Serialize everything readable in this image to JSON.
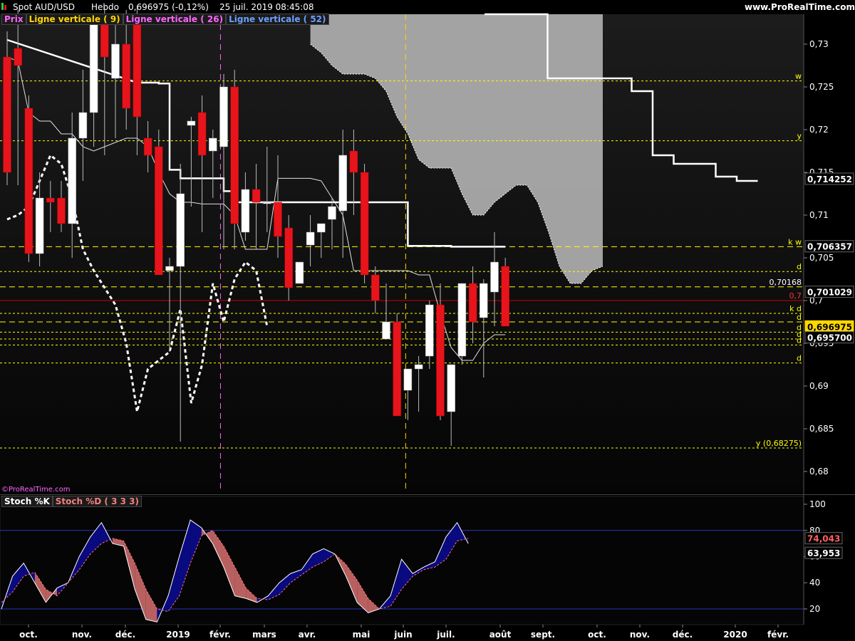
{
  "header": {
    "instrument": "Spot AUD/USD",
    "period": "Hebdo",
    "quote": "0,696975 (-0,12%)",
    "datetime": "25 juil. 2019 08:45:08",
    "site": "www.ProRealTime.com"
  },
  "legend": {
    "prix": "Prix",
    "lv9": "Ligne verticale ( 9)",
    "lv26": "Ligne verticale ( 26)",
    "lv52": "Ligne verticale ( 52)",
    "watermark": "©ProRealTime.com"
  },
  "stoch_legend": {
    "k": "Stoch %K",
    "d": "Stoch %D ( 3 3 3)"
  },
  "colors": {
    "bull": "#ffffff",
    "bear": "#e8141c",
    "level_line": "#ffff00",
    "cloud": "#b3b3b3",
    "k_fill_up": "#0a0a80",
    "k_fill_down": "#b86060",
    "lv9": "#ffd700",
    "lv26": "#ff66ff",
    "lv52": "#6f9fff"
  },
  "chart_data": {
    "type": "candlestick",
    "x_labels": [
      "oct.",
      "nov.",
      "déc.",
      "2019",
      "févr.",
      "mars",
      "avr.",
      "mai",
      "juin",
      "juil.",
      "août",
      "sept.",
      "oct.",
      "nov.",
      "déc.",
      "2020",
      "févr."
    ],
    "y_ticks": [
      "0,73",
      "0,725",
      "0,72",
      "0,715",
      "0,71",
      "0,705",
      "0,7",
      "0,695",
      "0,69",
      "0,685",
      "0,68"
    ],
    "ylim": [
      0.6775,
      0.7335
    ],
    "candles": [
      [
        0.7285,
        0.7315,
        0.7135,
        0.715
      ],
      [
        0.7295,
        0.734,
        0.7135,
        0.7275
      ],
      [
        0.7225,
        0.724,
        0.7045,
        0.7055
      ],
      [
        0.7055,
        0.715,
        0.704,
        0.712
      ],
      [
        0.712,
        0.714,
        0.708,
        0.7115
      ],
      [
        0.712,
        0.714,
        0.708,
        0.709
      ],
      [
        0.709,
        0.722,
        0.705,
        0.719
      ],
      [
        0.719,
        0.727,
        0.714,
        0.722
      ],
      [
        0.722,
        0.733,
        0.718,
        0.7335
      ],
      [
        0.7335,
        0.7345,
        0.717,
        0.7285
      ],
      [
        0.726,
        0.733,
        0.719,
        0.73
      ],
      [
        0.73,
        0.734,
        0.72,
        0.7225
      ],
      [
        0.7335,
        0.7345,
        0.717,
        0.7215
      ],
      [
        0.719,
        0.721,
        0.715,
        0.717
      ],
      [
        0.718,
        0.72,
        0.703,
        0.703
      ],
      [
        0.7035,
        0.705,
        0.694,
        0.704
      ],
      [
        0.704,
        0.716,
        0.6835,
        0.7125
      ],
      [
        0.7205,
        0.7215,
        0.711,
        0.721
      ],
      [
        0.722,
        0.724,
        0.708,
        0.717
      ],
      [
        0.7175,
        0.72,
        0.712,
        0.719
      ],
      [
        0.718,
        0.7265,
        0.706,
        0.725
      ],
      [
        0.725,
        0.727,
        0.706,
        0.709
      ],
      [
        0.708,
        0.715,
        0.707,
        0.713
      ],
      [
        0.713,
        0.716,
        0.706,
        0.7115
      ],
      [
        0.7115,
        0.718,
        0.708,
        0.7115
      ],
      [
        0.7115,
        0.717,
        0.705,
        0.7075
      ],
      [
        0.7085,
        0.71,
        0.7,
        0.7015
      ],
      [
        0.702,
        0.704,
        0.702,
        0.7045
      ],
      [
        0.7065,
        0.71,
        0.704,
        0.708
      ],
      [
        0.708,
        0.709,
        0.705,
        0.709
      ],
      [
        0.7095,
        0.712,
        0.706,
        0.711
      ],
      [
        0.7105,
        0.72,
        0.705,
        0.717
      ],
      [
        0.7175,
        0.72,
        0.71,
        0.715
      ],
      [
        0.715,
        0.716,
        0.702,
        0.703
      ],
      [
        0.703,
        0.704,
        0.6985,
        0.7
      ],
      [
        0.6955,
        0.702,
        0.6955,
        0.6975
      ],
      [
        0.6975,
        0.6985,
        0.6865,
        0.6865
      ],
      [
        0.6895,
        0.6905,
        0.686,
        0.692
      ],
      [
        0.692,
        0.6935,
        0.687,
        0.6925
      ],
      [
        0.6935,
        0.7,
        0.692,
        0.6995
      ],
      [
        0.6995,
        0.702,
        0.686,
        0.6865
      ],
      [
        0.687,
        0.6925,
        0.683,
        0.6925
      ],
      [
        0.6935,
        0.702,
        0.6925,
        0.702
      ],
      [
        0.702,
        0.704,
        0.695,
        0.6975
      ],
      [
        0.698,
        0.7025,
        0.691,
        0.702
      ],
      [
        0.701,
        0.708,
        0.697,
        0.7045
      ],
      [
        0.704,
        0.705,
        0.697,
        0.697
      ]
    ],
    "kijun": [
      0.7305,
      null,
      null,
      null,
      null,
      null,
      null,
      null,
      null,
      null,
      null,
      null,
      0.7255,
      0.7255,
      0.7254,
      0.7153,
      0.7143,
      0.7143,
      0.7143,
      0.7143,
      0.7128,
      0.7115,
      0.7115,
      0.7115,
      0.7115,
      0.7115,
      0.7115,
      0.7115,
      0.7115,
      0.7115,
      0.7115,
      0.7115,
      0.7115,
      0.7115,
      0.7115,
      0.7115,
      0.7115,
      0.7064,
      0.7064,
      0.7064,
      0.7064,
      0.7063,
      0.7063,
      0.7063,
      0.7063,
      0.7063,
      0.7063
    ],
    "tenkan": [
      0.7285,
      0.728,
      0.722,
      0.721,
      0.721,
      0.7195,
      0.7195,
      0.718,
      0.7175,
      0.718,
      0.7185,
      0.719,
      0.719,
      0.718,
      0.715,
      0.7125,
      0.7115,
      0.7115,
      0.7113,
      0.7113,
      0.7113,
      0.71,
      0.706,
      0.706,
      0.706,
      0.7143,
      0.7143,
      0.7143,
      0.7143,
      0.714,
      0.712,
      0.71,
      0.7035,
      0.7035,
      0.7035,
      0.7035,
      0.7035,
      0.7035,
      0.703,
      0.703,
      0.6985,
      0.6945,
      0.693,
      0.693,
      0.695,
      0.696,
      0.696
    ],
    "chikou": [
      0.7095,
      0.71,
      0.711,
      0.714,
      0.717,
      0.716,
      0.712,
      0.706,
      0.7035,
      0.7015,
      0.6995,
      0.695,
      0.687,
      0.692,
      0.693,
      0.694,
      0.699,
      0.688,
      0.6925,
      0.702,
      0.6975,
      0.7025,
      0.7045,
      0.7035,
      0.697
    ],
    "senkou_upper": [
      0.73,
      0.729,
      0.7275,
      0.7265,
      0.7265,
      0.7265,
      0.726,
      0.7245,
      0.7215,
      0.7195,
      0.7165,
      0.7155,
      0.7155,
      0.7155,
      0.7125,
      0.71,
      0.71,
      0.7115,
      0.7125,
      0.7135,
      0.7135,
      0.7115,
      0.708,
      0.704,
      0.702,
      0.702,
      0.7035,
      0.704
    ],
    "senkou_lower": [
      0.7335,
      0.7335,
      0.7335,
      0.7335,
      0.7335,
      0.7335,
      0.7335,
      0.7335,
      0.7335,
      0.7335,
      0.7335,
      0.7335,
      0.7335,
      0.7335,
      0.7335,
      0.7335,
      0.7335,
      0.7335,
      0.7335,
      0.7335,
      0.7335,
      0.7335,
      0.7335,
      0.7335,
      0.7335,
      0.7335,
      0.7335,
      0.7335
    ],
    "senkou_start_index": 28,
    "right_line": [
      0.7335,
      0.7335,
      0.7335,
      0.726,
      0.726,
      0.726,
      0.726,
      0.7245,
      0.717,
      0.716,
      0.716,
      0.7145,
      0.714,
      0.714
    ],
    "right_line_start_index": 47,
    "levels": [
      {
        "value": 0.7257,
        "label": "w",
        "style": "dotted"
      },
      {
        "value": 0.7187,
        "label": "y",
        "style": "dotted"
      },
      {
        "value": 0.7063,
        "label": "k w",
        "style": "dashed"
      },
      {
        "value": 0.7034,
        "label": "d",
        "style": "dotted"
      },
      {
        "value": 0.7016,
        "label": "",
        "style": "dashed"
      },
      {
        "value": 0.6985,
        "label": "k d",
        "style": "dotted"
      },
      {
        "value": 0.6975,
        "label": "d",
        "style": "dashed"
      },
      {
        "value": 0.6963,
        "label": "d",
        "style": "dotted"
      },
      {
        "value": 0.6955,
        "label": "d",
        "style": "dotted"
      },
      {
        "value": 0.6948,
        "label": "d",
        "style": "dotted"
      },
      {
        "value": 0.6927,
        "label": "d",
        "style": "dotted"
      },
      {
        "value": 0.68275,
        "label": "y (0,68275)",
        "style": "dotted"
      }
    ],
    "red_level": {
      "value": 0.7,
      "label": "0,7"
    },
    "price_tags": [
      {
        "value": 0.714252,
        "text": "0,714252",
        "bg": "#000000",
        "fg": "#ffffff"
      },
      {
        "value": 0.706357,
        "text": "0,706357",
        "bg": "#000000",
        "fg": "#ffffff"
      },
      {
        "value": 0.701029,
        "text": "0,701029",
        "bg": "#000000",
        "fg": "#ffffff"
      },
      {
        "value": 0.696975,
        "text": "0,696975",
        "bg": "#ffd700",
        "fg": "#000000"
      },
      {
        "value": 0.6957,
        "text": "0,695700",
        "bg": "#000000",
        "fg": "#ffffff"
      }
    ],
    "inner_tags": [
      {
        "value": 0.7016,
        "text": "0,70168"
      }
    ],
    "vlines": [
      {
        "index": 19.7,
        "color": "#ff66ff"
      },
      {
        "index": 36.8,
        "color": "#ffd700"
      }
    ],
    "stoch": {
      "ylim": [
        8,
        106
      ],
      "y_ticks": [
        "100",
        "80",
        "60",
        "40",
        "20"
      ],
      "bands": [
        80,
        20
      ],
      "k": [
        20,
        45,
        55,
        40,
        25,
        36,
        40,
        60,
        75,
        86,
        70,
        68,
        35,
        12,
        10,
        30,
        60,
        88,
        82,
        70,
        52,
        30,
        28,
        25,
        30,
        40,
        47,
        50,
        62,
        66,
        62,
        45,
        25,
        17,
        20,
        30,
        58,
        47,
        52,
        56,
        75,
        86,
        70
      ],
      "d": [
        25,
        33,
        45,
        48,
        35,
        30,
        40,
        50,
        62,
        70,
        74,
        72,
        55,
        35,
        20,
        18,
        30,
        55,
        76,
        80,
        68,
        52,
        36,
        28,
        27,
        31,
        40,
        46,
        52,
        56,
        62,
        54,
        42,
        28,
        20,
        22,
        35,
        45,
        50,
        52,
        58,
        72,
        74
      ],
      "k_last": "63,953",
      "d_last": "74,043"
    }
  }
}
